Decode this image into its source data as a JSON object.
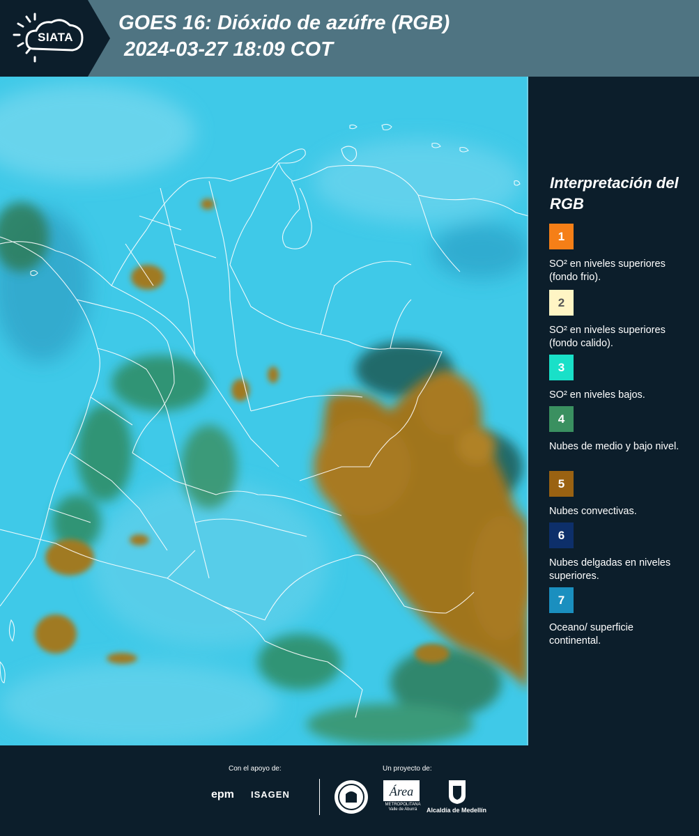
{
  "header": {
    "logo_text": "SIATA",
    "title_line1": "GOES 16: Dióxido de azúfre (RGB)",
    "title_line2": "2024-03-27 18:09 COT"
  },
  "legend": {
    "title": "Interpretación del RGB",
    "items": [
      {
        "number": "1",
        "color": "#f57f17",
        "text": "SO² en niveles superiores (fondo frio)."
      },
      {
        "number": "2",
        "color": "#fff5c4",
        "text": "SO² en niveles superiores (fondo calido)."
      },
      {
        "number": "3",
        "color": "#19e0c8",
        "text": "SO² en niveles bajos."
      },
      {
        "number": "4",
        "color": "#3a9060",
        "text": "Nubes de medio y bajo nivel."
      },
      {
        "number": "5",
        "color": "#9a6212",
        "text": "Nubes convectivas."
      },
      {
        "number": "6",
        "color": "#0d2f6a",
        "text": "Nubes delgadas en niveles superiores."
      },
      {
        "number": "7",
        "color": "#1a8fbf",
        "text": "Oceano/ superficie continental."
      }
    ]
  },
  "footer": {
    "support_label": "Con el apoyo de:",
    "project_label": "Un proyecto de:",
    "epm": "epm",
    "isagen": "ISAGEN",
    "area_text": "METROPOLITANA Valle de Aburrá",
    "alcaldia": "Alcaldía de Medellín"
  },
  "colors": {
    "header_bg": "#4f7482",
    "panel_bg": "#0c1e2b",
    "map_base": "#3cc8e6"
  }
}
